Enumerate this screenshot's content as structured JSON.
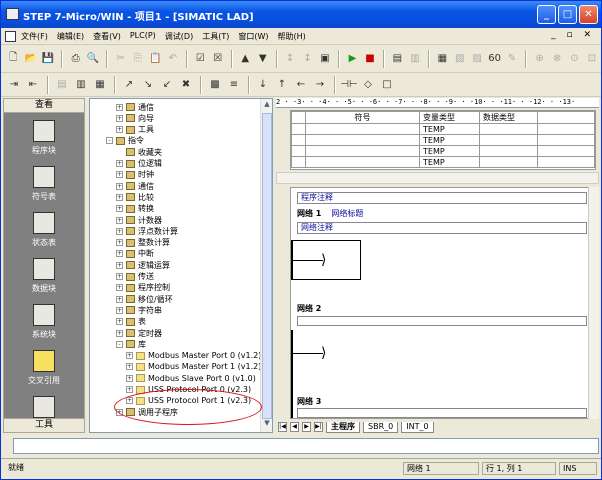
{
  "window": {
    "title": "STEP 7-Micro/WIN - 项目1 - [SIMATIC LAD]"
  },
  "menu": [
    "文件(F)",
    "编辑(E)",
    "查看(V)",
    "PLC(P)",
    "调试(D)",
    "工具(T)",
    "窗口(W)",
    "帮助(H)"
  ],
  "navbar": {
    "header": "查看",
    "items": [
      "程序块",
      "符号表",
      "状态表",
      "数据块",
      "系统块",
      "交叉引用"
    ],
    "footer": "工具"
  },
  "tree": [
    {
      "label": "通信",
      "indent": 1,
      "toggle": "+"
    },
    {
      "label": "向导",
      "indent": 1,
      "toggle": "+"
    },
    {
      "label": "工具",
      "indent": 1,
      "toggle": "+"
    },
    {
      "label": "指令",
      "indent": 0,
      "toggle": "-"
    },
    {
      "label": "收藏夹",
      "indent": 1,
      "toggle": ""
    },
    {
      "label": "位逻辑",
      "indent": 1,
      "toggle": "+"
    },
    {
      "label": "时钟",
      "indent": 1,
      "toggle": "+"
    },
    {
      "label": "通信",
      "indent": 1,
      "toggle": "+"
    },
    {
      "label": "比较",
      "indent": 1,
      "toggle": "+"
    },
    {
      "label": "转换",
      "indent": 1,
      "toggle": "+"
    },
    {
      "label": "计数器",
      "indent": 1,
      "toggle": "+"
    },
    {
      "label": "浮点数计算",
      "indent": 1,
      "toggle": "+"
    },
    {
      "label": "整数计算",
      "indent": 1,
      "toggle": "+"
    },
    {
      "label": "中断",
      "indent": 1,
      "toggle": "+"
    },
    {
      "label": "逻辑运算",
      "indent": 1,
      "toggle": "+"
    },
    {
      "label": "传送",
      "indent": 1,
      "toggle": "+"
    },
    {
      "label": "程序控制",
      "indent": 1,
      "toggle": "+"
    },
    {
      "label": "移位/循环",
      "indent": 1,
      "toggle": "+"
    },
    {
      "label": "字符串",
      "indent": 1,
      "toggle": "+"
    },
    {
      "label": "表",
      "indent": 1,
      "toggle": "+"
    },
    {
      "label": "定时器",
      "indent": 1,
      "toggle": "+"
    },
    {
      "label": "库",
      "indent": 1,
      "toggle": "-"
    },
    {
      "label": "Modbus Master Port 0 (v1.2)",
      "indent": 2,
      "toggle": "+"
    },
    {
      "label": "Modbus Master Port 1 (v1.2)",
      "indent": 2,
      "toggle": "+"
    },
    {
      "label": "Modbus Slave Port 0 (v1.0)",
      "indent": 2,
      "toggle": "+"
    },
    {
      "label": "USS Protocol Port 0 (v2.3)",
      "indent": 2,
      "toggle": "+"
    },
    {
      "label": "USS Protocol Port 1 (v2.3)",
      "indent": 2,
      "toggle": "+"
    },
    {
      "label": "调用子程序",
      "indent": 1,
      "toggle": "+"
    }
  ],
  "ruler": "2 · ·3· · ·4· · ·5· · ·6· · ·7· · ·8· · ·9· · ·10· · ·11· · ·12· · ·13·",
  "vartable": {
    "headers": [
      "符号",
      "变量类型",
      "数据类型"
    ],
    "rows": [
      [
        "",
        "TEMP",
        ""
      ],
      [
        "",
        "TEMP",
        ""
      ],
      [
        "",
        "TEMP",
        ""
      ],
      [
        "",
        "TEMP",
        ""
      ]
    ]
  },
  "ladder": {
    "program_comment": "程序注释",
    "networks": [
      {
        "label": "网络 1",
        "title": "网络标题",
        "comment": "网络注释"
      },
      {
        "label": "网络 2"
      },
      {
        "label": "网络 3"
      }
    ]
  },
  "tabs": [
    "主程序",
    "SBR_0",
    "INT_0"
  ],
  "status": {
    "ready": "就绪",
    "network": "网络 1",
    "position": "行 1, 列 1",
    "mode": "INS"
  }
}
